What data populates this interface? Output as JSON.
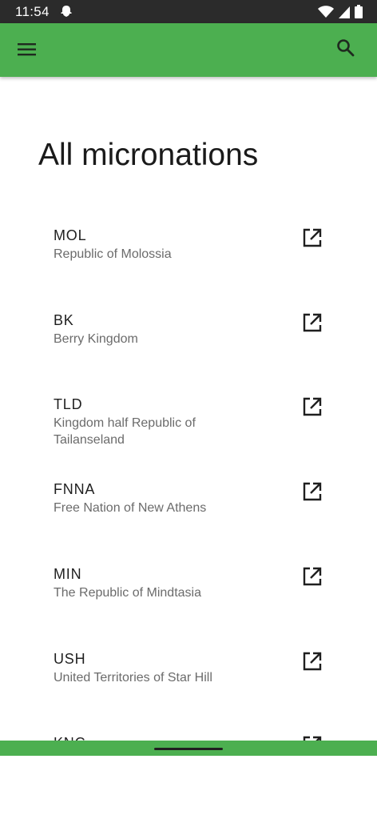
{
  "status_bar": {
    "time": "11:54"
  },
  "app_bar": {
    "menu_icon": "hamburger-menu-icon",
    "search_icon": "search-icon"
  },
  "page": {
    "title": "All micronations"
  },
  "list": {
    "items": [
      {
        "code": "MOL",
        "name": "Republic of Molossia",
        "icon": "open-in-new-icon"
      },
      {
        "code": "BK",
        "name": "Berry Kingdom",
        "icon": "open-in-new-icon"
      },
      {
        "code": "TLD",
        "name": "Kingdom half Republic of Tailanseland",
        "icon": "open-in-new-icon"
      },
      {
        "code": "FNNA",
        "name": "Free Nation of New Athens",
        "icon": "open-in-new-icon"
      },
      {
        "code": "MIN",
        "name": "The Republic of Mindtasia",
        "icon": "open-in-new-icon"
      },
      {
        "code": "USH",
        "name": "United Territories of Star Hill",
        "icon": "open-in-new-icon"
      },
      {
        "code": "KNC",
        "name": "",
        "icon": "open-in-new-icon"
      }
    ]
  },
  "colors": {
    "app_bar": "#4caf50",
    "status_bar": "#2b2b2b",
    "title": "#1a1a1a",
    "secondary_text": "#6b6b6b"
  }
}
